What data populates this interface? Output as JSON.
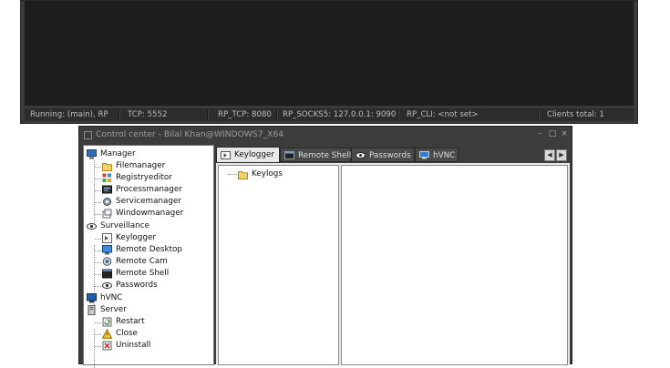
{
  "console": {
    "status": {
      "running": "Running: (main), RP",
      "tcp": "TCP: 5552",
      "rp_tcp": "RP_TCP: 8080",
      "rp_socks5": "RP_SOCKS5: 127.0.0.1: 9090",
      "rp_cli": "RP_CLI: <not set>",
      "clients": "Clients total: 1"
    }
  },
  "control_center": {
    "title": "Control center - Bilal Khan@WINDOWS7_X64",
    "window_buttons": {
      "minimize": "–",
      "restore": "□",
      "close": "×"
    },
    "tree": {
      "manager": {
        "label": "Manager",
        "items": [
          "Filemanager",
          "Registryeditor",
          "Processmanager",
          "Servicemanager",
          "Windowmanager"
        ]
      },
      "surveillance": {
        "label": "Surveillance",
        "items": [
          "Keylogger",
          "Remote Desktop",
          "Remote Cam",
          "Remote Shell",
          "Passwords"
        ]
      },
      "hvnc": {
        "label": "hVNC"
      },
      "server": {
        "label": "Server",
        "items": [
          "Restart",
          "Close",
          "Uninstall"
        ]
      }
    },
    "tabs": [
      {
        "label": "Keylogger",
        "active": true,
        "icon": "keylogger-icon"
      },
      {
        "label": "Remote Shell",
        "active": false,
        "icon": "terminal-icon"
      },
      {
        "label": "Passwords",
        "active": false,
        "icon": "eye-icon"
      },
      {
        "label": "hVNC",
        "active": false,
        "icon": "monitor-icon"
      }
    ],
    "tab_scroll": {
      "left": "◀",
      "right": "▶"
    },
    "keylogger": {
      "tree_root": "Keylogs"
    }
  }
}
